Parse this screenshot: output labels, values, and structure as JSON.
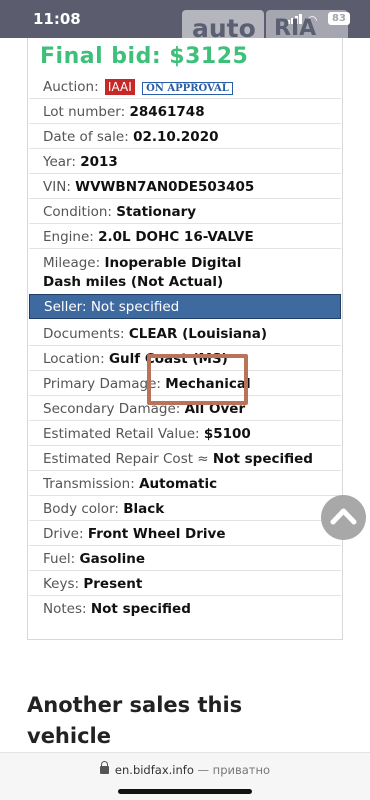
{
  "status_bar": {
    "time": "11:08",
    "battery": "83"
  },
  "watermark": {
    "left": "auto",
    "right": "RIA"
  },
  "final_bid": "Final bid: $3125",
  "auction": {
    "label": "Auction:",
    "source": "IAAI",
    "status": "ON APPROVAL"
  },
  "rows": [
    {
      "label": "Lot number:",
      "value": "28461748"
    },
    {
      "label": "Date of sale:",
      "value": "02.10.2020"
    },
    {
      "label": "Year:",
      "value": "2013"
    },
    {
      "label": "VIN:",
      "value": "WVWBN7AN0DE503405"
    },
    {
      "label": "Condition:",
      "value": "Stationary"
    },
    {
      "label": "Engine:",
      "value": "2.0L DOHC 16-VALVE"
    }
  ],
  "mileage": {
    "label": "Mileage:",
    "line1": "Inoperable Digital",
    "line2": "Dash miles (Not Actual)"
  },
  "seller": "Seller: Not specified",
  "rows2": [
    {
      "label": "Documents:",
      "value": "CLEAR (Louisiana)"
    },
    {
      "label": "Location:",
      "value": "Gulf Coast (MS)"
    },
    {
      "label": "Primary Damage:",
      "value": "Mechanical"
    },
    {
      "label": "Secondary Damage:",
      "value": "All Over"
    },
    {
      "label": "Estimated Retail Value:",
      "value": "$5100"
    },
    {
      "label": "Estimated Repair Cost ≈",
      "value": "Not specified"
    },
    {
      "label": "Transmission:",
      "value": "Automatic"
    },
    {
      "label": "Body color:",
      "value": "Black"
    },
    {
      "label": "Drive:",
      "value": "Front Wheel Drive"
    },
    {
      "label": "Fuel:",
      "value": "Gasoline"
    },
    {
      "label": "Keys:",
      "value": "Present"
    },
    {
      "label": "Notes:",
      "value": "Not specified"
    }
  ],
  "section_heading": "Another sales this vehicle",
  "browser": {
    "domain": "en.bidfax.info",
    "suffix": "— приватно"
  },
  "icons": {
    "lock": "lock-icon",
    "scroll_top": "chevron-up-icon",
    "signal": "signal-icon",
    "wifi": "wifi-icon",
    "battery": "battery-icon"
  },
  "colors": {
    "final_bid": "#3ec07a",
    "seller_bg": "#3f6aa0",
    "iaai": "#c62828",
    "approval": "#2a5ea8",
    "highlight": "#b8735a"
  }
}
